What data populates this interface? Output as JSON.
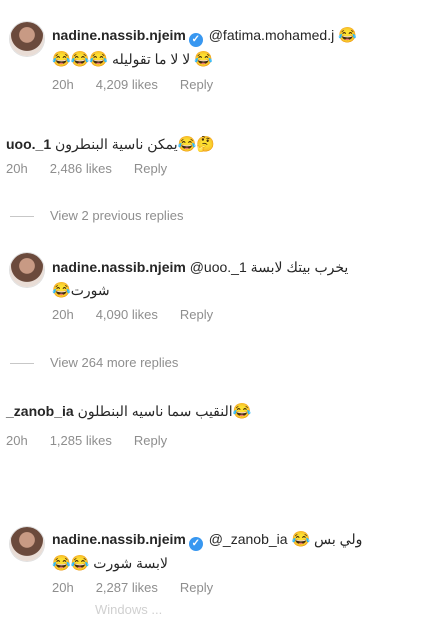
{
  "threads": [
    {
      "user": "nadine.nassib.njeim",
      "mention": "@fatima.mohamed.j",
      "text": "لا لا ما تقوليله",
      "time": "20h",
      "likes": "4,209 likes",
      "reply": "Reply"
    },
    {
      "user": "uoo._1",
      "text": "يمكن ناسية البنطرون",
      "time": "20h",
      "likes": "2,486 likes",
      "reply": "Reply"
    },
    {
      "toggle": "View 2 previous replies"
    },
    {
      "user": "nadine.nassib.njeim",
      "mention": "@uoo._1",
      "text": "يخرب بيتك لابسة",
      "text2": "شورت",
      "time": "20h",
      "likes": "4,090 likes",
      "reply": "Reply"
    },
    {
      "toggle": "View 264 more replies"
    },
    {
      "user": "_zanob_ia",
      "text": "النقيب سما ناسيه البنطلون",
      "time": "20h",
      "likes": "1,285 likes",
      "reply": "Reply"
    },
    {
      "user": "nadine.nassib.njeim",
      "mention": "@_zanob_ia",
      "text": "ولي بس",
      "text2": "لابسة شورت",
      "time": "20h",
      "likes": "2,287 likes",
      "reply": "Reply"
    }
  ],
  "watermark": "Windows ...",
  "icons": {
    "laugh": "😂",
    "thinking": "🤔",
    "verified": "✓"
  },
  "colors": {
    "verified": "#3897f0",
    "meta": "#8e8e8e",
    "text": "#262626"
  }
}
